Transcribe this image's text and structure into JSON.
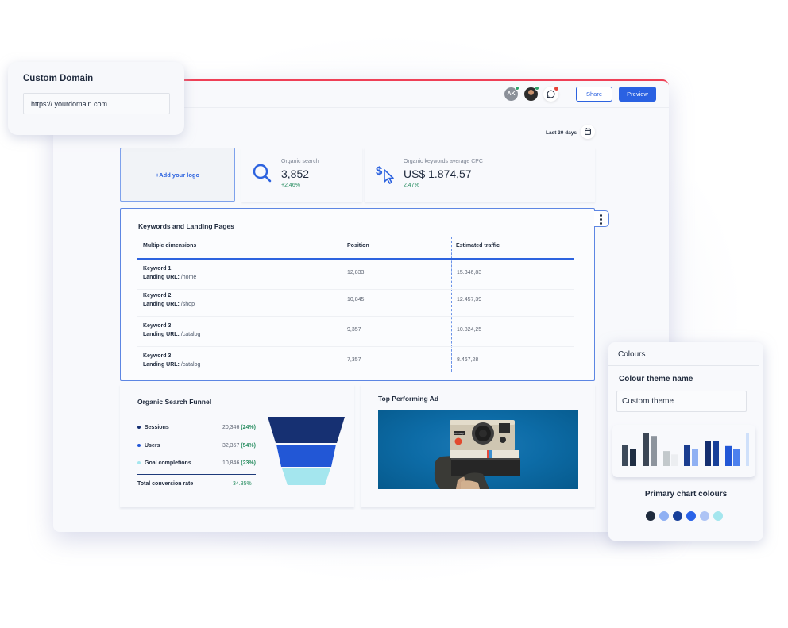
{
  "custom_domain": {
    "title": "Custom Domain",
    "input_value": "https:// yourdomain.com"
  },
  "topbar": {
    "avatar_initials": "AK",
    "share_label": "Share",
    "preview_label": "Preview",
    "icons": [
      "avatar-ak",
      "avatar-photo",
      "chat-icon"
    ]
  },
  "date_range": {
    "label": "Last 30 days",
    "icon": "calendar-icon"
  },
  "logo_placeholder": "+Add your logo",
  "kpis": [
    {
      "icon": "search-icon",
      "label": "Organic search",
      "value": "3,852",
      "delta": "+2.46%"
    },
    {
      "icon": "dollar-cursor-icon",
      "label": "Organic keywords average CPC",
      "value": "US$ 1.874,57",
      "delta": "2.47%"
    }
  ],
  "keywords_table": {
    "title": "Keywords and Landing Pages",
    "columns": [
      "Multiple dimensions",
      "Position",
      "Estimated traffic"
    ],
    "url_label": "Landing URL:",
    "rows": [
      {
        "keyword": "Keyword 1",
        "url": " /home",
        "position": "12,833",
        "traffic": "15.346,83"
      },
      {
        "keyword": "Keyword 2",
        "url": " /shop",
        "position": "10,845",
        "traffic": "12.457,39"
      },
      {
        "keyword": "Keyword 3",
        "url": " /catalog",
        "position": "9,357",
        "traffic": "10.824,25"
      },
      {
        "keyword": "Keyword 3",
        "url": " /catalog",
        "position": "7,357",
        "traffic": "8.467,28"
      }
    ]
  },
  "funnel": {
    "title": "Organic Search Funnel",
    "items": [
      {
        "label": "Sessions",
        "value": "20,346",
        "pct": "(24%)",
        "color": "#163072"
      },
      {
        "label": "Users",
        "value": "32,357",
        "pct": "(54%)",
        "color": "#2257d6"
      },
      {
        "label": "Goal completions",
        "value": "10,846",
        "pct": "(23%)",
        "color": "#a4e6ee"
      }
    ],
    "total_label": "Total conversion rate",
    "total_value": "34.35%"
  },
  "top_ad": {
    "title": "Top Performing Ad",
    "camera_badge": "OneStep"
  },
  "colours_panel": {
    "header": "Colours",
    "theme_name_label": "Colour theme name",
    "theme_name_value": "Custom theme",
    "preview_bar_pairs": [
      {
        "colors": [
          "#3d4a5a",
          "#1f2e43"
        ],
        "heights": [
          0.62,
          0.5
        ]
      },
      {
        "colors": [
          "#3b4655",
          "#8d949d"
        ],
        "heights": [
          1.0,
          0.9
        ]
      },
      {
        "colors": [
          "#c3c9cc",
          "#eceef1"
        ],
        "heights": [
          0.45,
          0.35
        ]
      },
      {
        "colors": [
          "#1a3d8f",
          "#8fb0f3"
        ],
        "heights": [
          0.62,
          0.5
        ]
      },
      {
        "colors": [
          "#142e6f",
          "#173f99"
        ],
        "heights": [
          0.75,
          0.75
        ]
      },
      {
        "colors": [
          "#2257d6",
          "#4d81ee"
        ],
        "heights": [
          0.6,
          0.5
        ]
      },
      {
        "colors": [
          "#cfe0fa",
          "#a4e6ee"
        ],
        "heights": [
          1.0,
          0.82
        ]
      }
    ],
    "primary_label": "Primary chart colours",
    "primary_colors": [
      "#1f2b3d",
      "#8fb0f3",
      "#173f99",
      "#2a63e8",
      "#aec4f5",
      "#a4e6ee"
    ]
  },
  "colors": {
    "accent_blue": "#2a61e2",
    "positive_green": "#2b8f63",
    "top_border_red": "#ef4056"
  }
}
